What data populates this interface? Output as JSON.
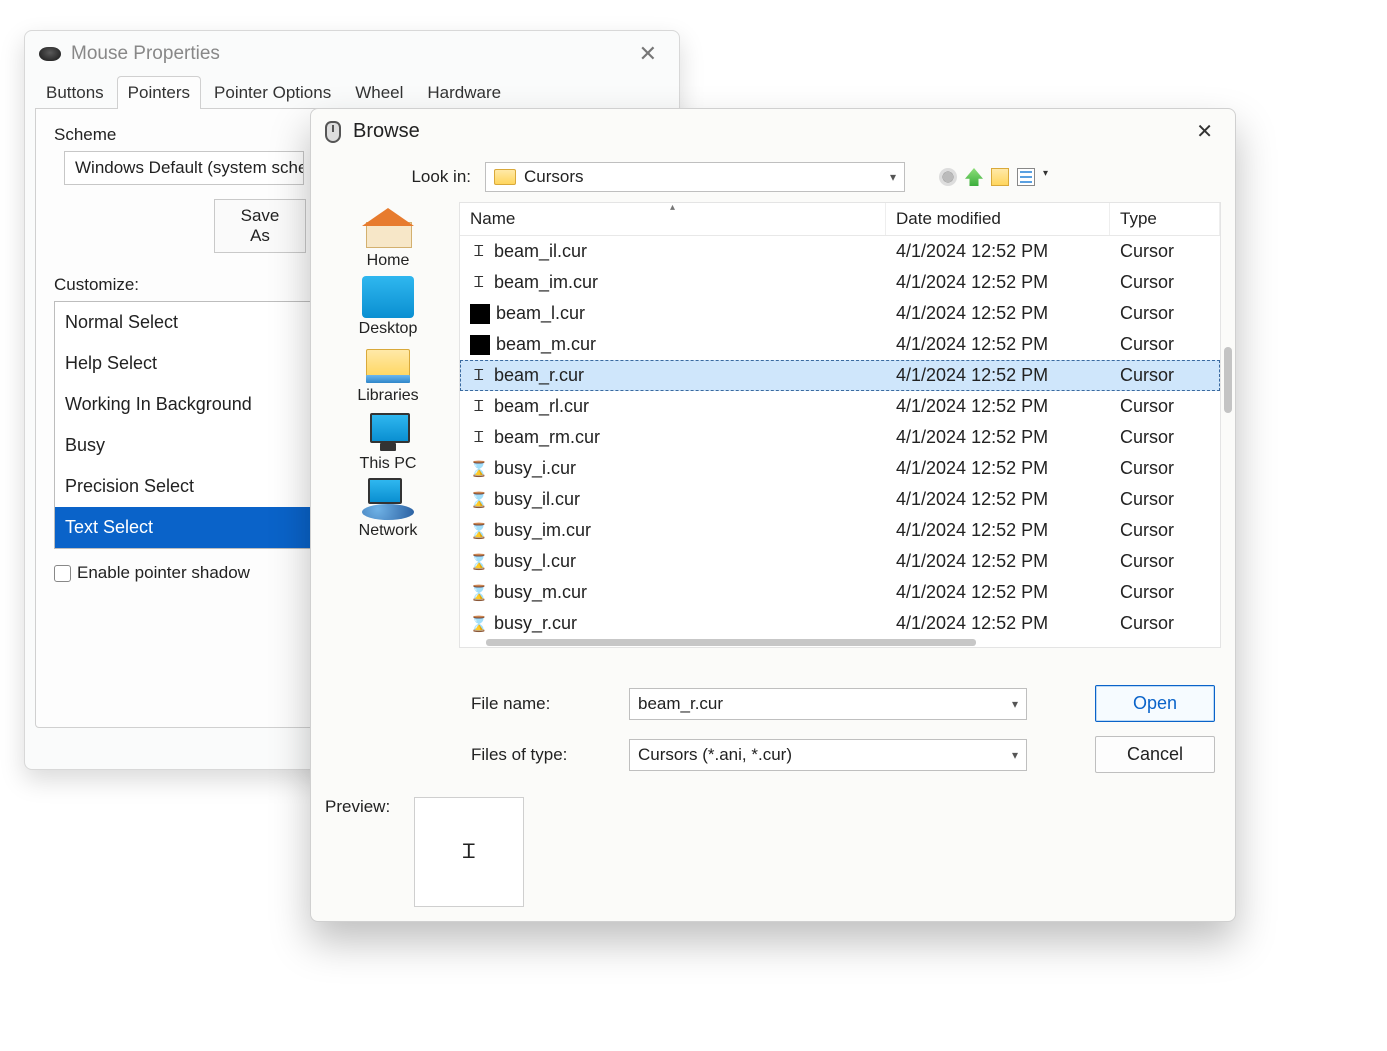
{
  "mouse": {
    "title": "Mouse Properties",
    "tabs": [
      "Buttons",
      "Pointers",
      "Pointer Options",
      "Wheel",
      "Hardware"
    ],
    "active_tab": 1,
    "scheme_label": "Scheme",
    "scheme_value": "Windows Default (system scheme)",
    "save_as": "Save As",
    "customize_label": "Customize:",
    "customize_items": [
      "Normal Select",
      "Help Select",
      "Working In Background",
      "Busy",
      "Precision Select",
      "Text Select"
    ],
    "customize_selected": 5,
    "shadow_label": "Enable pointer shadow",
    "shadow_checked": false
  },
  "browse": {
    "title": "Browse",
    "look_in_label": "Look in:",
    "look_in_value": "Cursors",
    "places": [
      {
        "label": "Home",
        "icon": "home"
      },
      {
        "label": "Desktop",
        "icon": "desktop"
      },
      {
        "label": "Libraries",
        "icon": "libraries"
      },
      {
        "label": "This PC",
        "icon": "thispc"
      },
      {
        "label": "Network",
        "icon": "network"
      }
    ],
    "columns": {
      "name": "Name",
      "date": "Date modified",
      "type": "Type"
    },
    "files": [
      {
        "icon": "ibeam",
        "name": "beam_il.cur",
        "date": "4/1/2024 12:52 PM",
        "type": "Cursor"
      },
      {
        "icon": "ibeam",
        "name": "beam_im.cur",
        "date": "4/1/2024 12:52 PM",
        "type": "Cursor"
      },
      {
        "icon": "black",
        "name": "beam_l.cur",
        "date": "4/1/2024 12:52 PM",
        "type": "Cursor"
      },
      {
        "icon": "black",
        "name": "beam_m.cur",
        "date": "4/1/2024 12:52 PM",
        "type": "Cursor"
      },
      {
        "icon": "ibeam",
        "name": "beam_r.cur",
        "date": "4/1/2024 12:52 PM",
        "type": "Cursor",
        "selected": true
      },
      {
        "icon": "ibeam",
        "name": "beam_rl.cur",
        "date": "4/1/2024 12:52 PM",
        "type": "Cursor"
      },
      {
        "icon": "ibeam",
        "name": "beam_rm.cur",
        "date": "4/1/2024 12:52 PM",
        "type": "Cursor"
      },
      {
        "icon": "hour",
        "name": "busy_i.cur",
        "date": "4/1/2024 12:52 PM",
        "type": "Cursor"
      },
      {
        "icon": "hour",
        "name": "busy_il.cur",
        "date": "4/1/2024 12:52 PM",
        "type": "Cursor"
      },
      {
        "icon": "hour",
        "name": "busy_im.cur",
        "date": "4/1/2024 12:52 PM",
        "type": "Cursor"
      },
      {
        "icon": "hour",
        "name": "busy_l.cur",
        "date": "4/1/2024 12:52 PM",
        "type": "Cursor"
      },
      {
        "icon": "hour",
        "name": "busy_m.cur",
        "date": "4/1/2024 12:52 PM",
        "type": "Cursor"
      },
      {
        "icon": "hour",
        "name": "busy_r.cur",
        "date": "4/1/2024 12:52 PM",
        "type": "Cursor"
      }
    ],
    "file_name_label": "File name:",
    "file_name_value": "beam_r.cur",
    "file_type_label": "Files of type:",
    "file_type_value": "Cursors (*.ani, *.cur)",
    "open": "Open",
    "cancel": "Cancel",
    "preview_label": "Preview:",
    "preview_glyph": "Ꮖ"
  }
}
